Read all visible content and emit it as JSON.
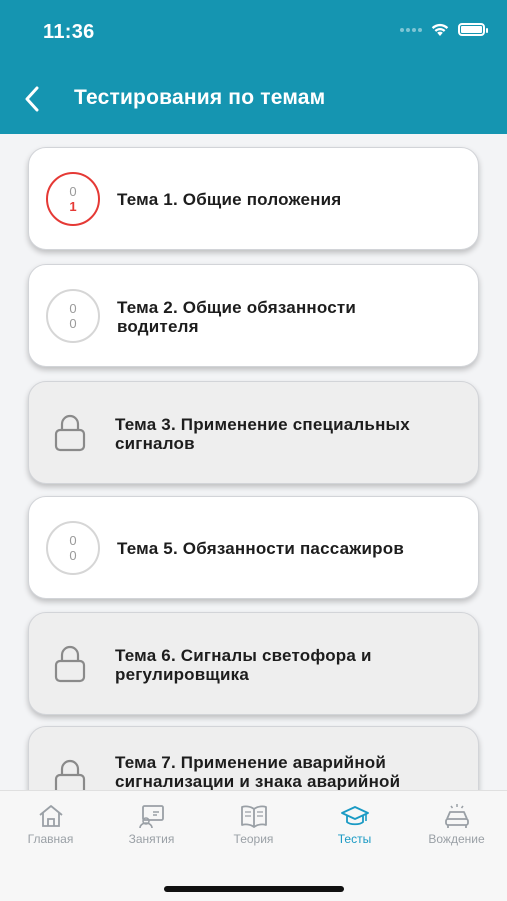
{
  "status": {
    "time": "11:36"
  },
  "header": {
    "title": "Тестирования по темам"
  },
  "topics": [
    {
      "title_line1": "Тема 1.  Общие положения",
      "title_line2": "",
      "state": "progress",
      "correct": "0",
      "wrong": "1"
    },
    {
      "title_line1": "Тема 2.  Общие обязанности",
      "title_line2": "водителя",
      "state": "progress",
      "correct": "0",
      "wrong": "0"
    },
    {
      "title_line1": "Тема 3.  Применение специальных",
      "title_line2": "сигналов",
      "state": "locked"
    },
    {
      "title_line1": "Тема 5. Обязанности пассажиров",
      "title_line2": "",
      "state": "progress",
      "correct": "0",
      "wrong": "0"
    },
    {
      "title_line1": "Тема 6.  Сигналы светофора и",
      "title_line2": "регулировщика",
      "state": "locked"
    },
    {
      "title_line1": "Тема 7.  Применение аварийной",
      "title_line2": "сигнализации и знака аварийной",
      "state": "locked"
    }
  ],
  "tabs": [
    {
      "label": "Главная",
      "icon": "home-icon"
    },
    {
      "label": "Занятия",
      "icon": "lessons-icon"
    },
    {
      "label": "Теория",
      "icon": "book-icon"
    },
    {
      "label": "Тесты",
      "icon": "graduation-cap-icon",
      "active": true
    },
    {
      "label": "Вождение",
      "icon": "car-icon"
    }
  ],
  "colors": {
    "header": "#1595b1",
    "accent": "#1a9ac4",
    "error": "#e53935"
  }
}
